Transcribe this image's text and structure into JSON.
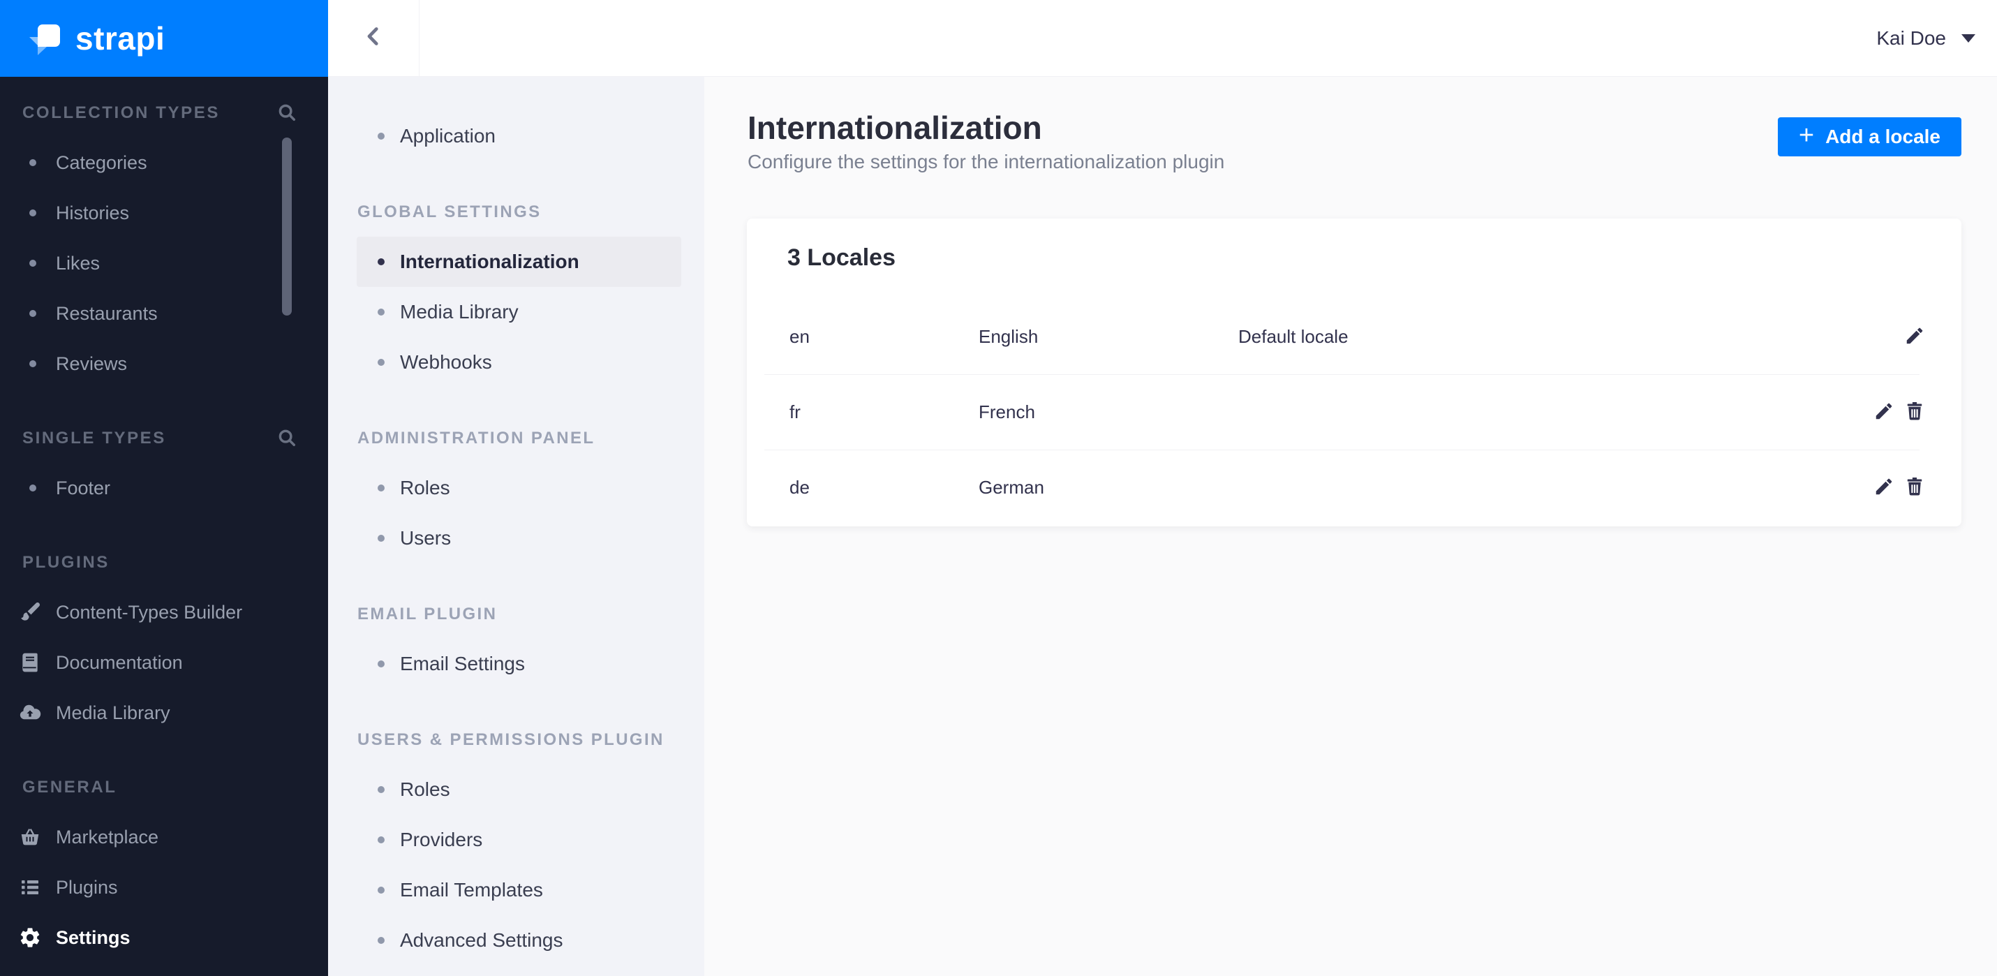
{
  "colors": {
    "accent_blue": "#007EFF",
    "sidebar_dark_bg": "#161B2B",
    "sidebar_light_bg": "#F2F3F8",
    "main_bg": "#FAFAFB",
    "card_bg": "#FFFFFF",
    "text_dark": "#32324D"
  },
  "logo": {
    "text": "strapi",
    "icon": "strapi-mark"
  },
  "sidebar": {
    "sections": [
      {
        "title": "COLLECTION TYPES",
        "search_icon": "magnifier",
        "items": [
          {
            "label": "Categories"
          },
          {
            "label": "Histories"
          },
          {
            "label": "Likes"
          },
          {
            "label": "Restaurants"
          },
          {
            "label": "Reviews"
          }
        ]
      },
      {
        "title": "SINGLE TYPES",
        "search_icon": "magnifier",
        "items": [
          {
            "label": "Footer"
          }
        ]
      },
      {
        "title": "PLUGINS",
        "items": [
          {
            "label": "Content-Types Builder",
            "icon": "brush-icon"
          },
          {
            "label": "Documentation",
            "icon": "book-icon"
          },
          {
            "label": "Media Library",
            "icon": "cloud-upload-icon"
          }
        ]
      },
      {
        "title": "GENERAL",
        "items": [
          {
            "label": "Marketplace",
            "icon": "basket-icon"
          },
          {
            "label": "Plugins",
            "icon": "list-icon"
          },
          {
            "label": "Settings",
            "icon": "gear-icon",
            "active": true
          }
        ]
      }
    ]
  },
  "header": {
    "user_name": "Kai Doe",
    "caret_icon": "caret-down"
  },
  "settings_nav": {
    "back_icon": "chevron-left",
    "groups": [
      {
        "items": [
          {
            "label": "Application"
          }
        ]
      },
      {
        "title": "GLOBAL SETTINGS",
        "items": [
          {
            "label": "Internationalization",
            "active": true
          },
          {
            "label": "Media Library"
          },
          {
            "label": "Webhooks"
          }
        ]
      },
      {
        "title": "ADMINISTRATION PANEL",
        "items": [
          {
            "label": "Roles"
          },
          {
            "label": "Users"
          }
        ]
      },
      {
        "title": "EMAIL PLUGIN",
        "items": [
          {
            "label": "Email Settings"
          }
        ]
      },
      {
        "title": "USERS & PERMISSIONS PLUGIN",
        "items": [
          {
            "label": "Roles"
          },
          {
            "label": "Providers"
          },
          {
            "label": "Email Templates"
          },
          {
            "label": "Advanced Settings"
          }
        ]
      }
    ]
  },
  "main": {
    "title": "Internationalization",
    "subtitle": "Configure the settings for the internationalization plugin",
    "add_button": {
      "plus": "+",
      "label": "Add a locale"
    },
    "card": {
      "title": "3 Locales",
      "rows": [
        {
          "code": "en",
          "name": "English",
          "status": "Default locale",
          "actions": [
            "edit"
          ]
        },
        {
          "code": "fr",
          "name": "French",
          "status": "",
          "actions": [
            "edit",
            "delete"
          ]
        },
        {
          "code": "de",
          "name": "German",
          "status": "",
          "actions": [
            "edit",
            "delete"
          ]
        }
      ]
    }
  }
}
